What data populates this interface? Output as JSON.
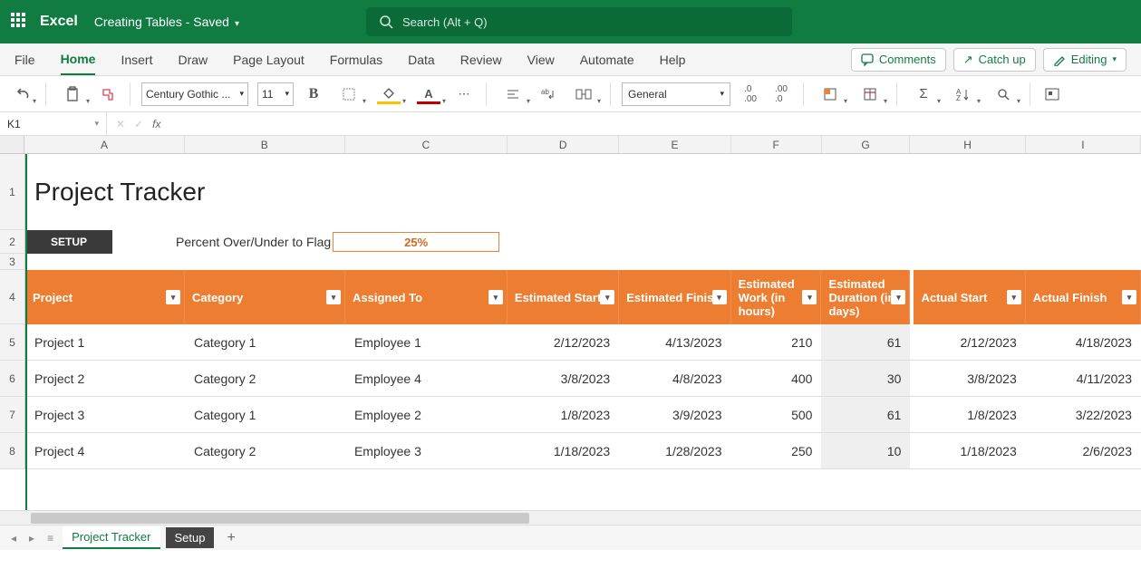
{
  "app": {
    "name": "Excel",
    "doc": "Creating Tables - Saved"
  },
  "search": {
    "placeholder": "Search (Alt + Q)"
  },
  "tabs": {
    "file": "File",
    "home": "Home",
    "insert": "Insert",
    "draw": "Draw",
    "pagelayout": "Page Layout",
    "formulas": "Formulas",
    "data": "Data",
    "review": "Review",
    "view": "View",
    "automate": "Automate",
    "help": "Help"
  },
  "actions": {
    "comments": "Comments",
    "catchup": "Catch up",
    "editing": "Editing"
  },
  "ribbon": {
    "font": "Century Gothic ...",
    "size": "11",
    "numfmt": "General"
  },
  "namebox": "K1",
  "columns": {
    "A": "A",
    "B": "B",
    "C": "C",
    "D": "D",
    "E": "E",
    "F": "F",
    "G": "G",
    "H": "H",
    "I": "I"
  },
  "rows": {
    "r1": "1",
    "r2": "2",
    "r3": "3",
    "r4": "4",
    "r5": "5",
    "r6": "6",
    "r7": "7",
    "r8": "8"
  },
  "title": "Project Tracker",
  "setup": {
    "button": "SETUP",
    "label": "Percent Over/Under to Flag",
    "value": "25%"
  },
  "headers": {
    "project": "Project",
    "category": "Category",
    "assigned": "Assigned To",
    "eststart": "Estimated Start",
    "estfinish": "Estimated Finish",
    "estwork": "Estimated Work (in hours)",
    "estdur": "Estimated Duration (in days)",
    "actstart": "Actual Start",
    "actfinish": "Actual Finish"
  },
  "data": [
    {
      "project": "Project 1",
      "category": "Category 1",
      "assigned": "Employee 1",
      "eststart": "2/12/2023",
      "estfinish": "4/13/2023",
      "estwork": "210",
      "estdur": "61",
      "actstart": "2/12/2023",
      "actfinish": "4/18/2023"
    },
    {
      "project": "Project 2",
      "category": "Category 2",
      "assigned": "Employee 4",
      "eststart": "3/8/2023",
      "estfinish": "4/8/2023",
      "estwork": "400",
      "estdur": "30",
      "actstart": "3/8/2023",
      "actfinish": "4/11/2023"
    },
    {
      "project": "Project 3",
      "category": "Category 1",
      "assigned": "Employee 2",
      "eststart": "1/8/2023",
      "estfinish": "3/9/2023",
      "estwork": "500",
      "estdur": "61",
      "actstart": "1/8/2023",
      "actfinish": "3/22/2023"
    },
    {
      "project": "Project 4",
      "category": "Category 2",
      "assigned": "Employee 3",
      "eststart": "1/18/2023",
      "estfinish": "1/28/2023",
      "estwork": "250",
      "estdur": "10",
      "actstart": "1/18/2023",
      "actfinish": "2/6/2023"
    }
  ],
  "sheets": {
    "s1": "Project Tracker",
    "s2": "Setup"
  }
}
